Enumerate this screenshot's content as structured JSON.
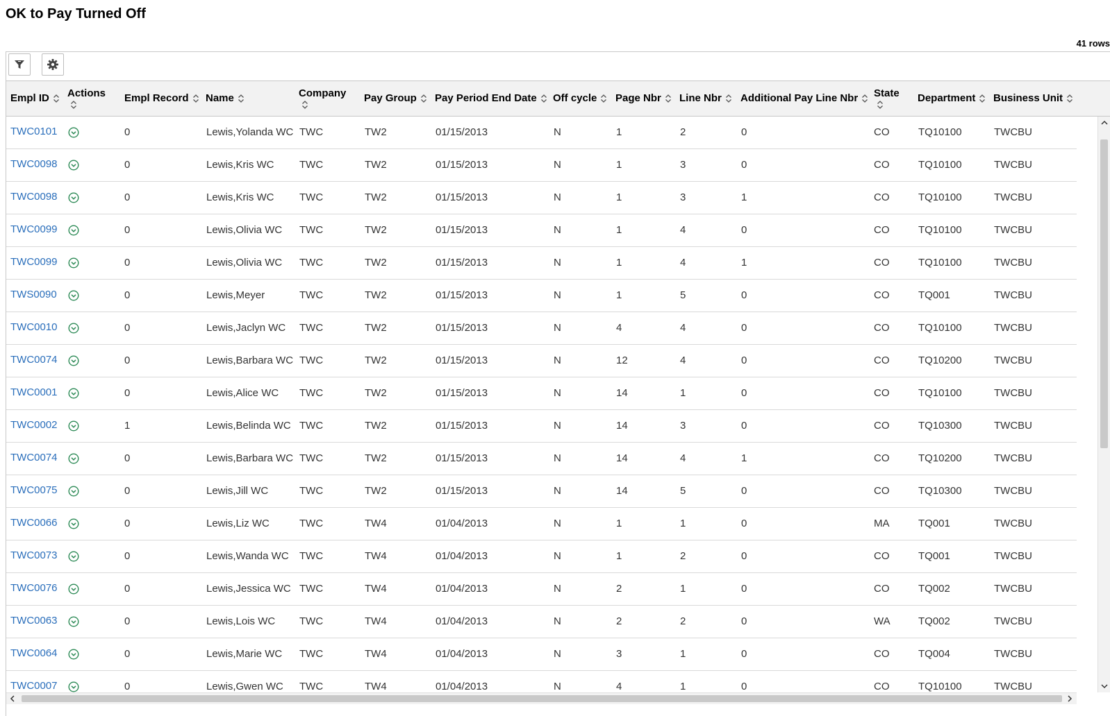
{
  "page": {
    "title": "OK to Pay Turned Off",
    "row_count": "41 rows"
  },
  "toolbar": {
    "filter_icon": "filter-icon",
    "settings_icon": "gear-icon"
  },
  "columns": [
    {
      "key": "empl_id",
      "label": "Empl ID"
    },
    {
      "key": "actions",
      "label": "Actions"
    },
    {
      "key": "empl_record",
      "label": "Empl Record"
    },
    {
      "key": "name",
      "label": "Name"
    },
    {
      "key": "company",
      "label": "Company"
    },
    {
      "key": "pay_group",
      "label": "Pay Group"
    },
    {
      "key": "pay_period_end_date",
      "label": "Pay Period End Date"
    },
    {
      "key": "off_cycle",
      "label": "Off cycle"
    },
    {
      "key": "page_nbr",
      "label": "Page Nbr"
    },
    {
      "key": "line_nbr",
      "label": "Line Nbr"
    },
    {
      "key": "add_pay_line_nbr",
      "label": "Additional Pay Line Nbr"
    },
    {
      "key": "state",
      "label": "State"
    },
    {
      "key": "department",
      "label": "Department"
    },
    {
      "key": "business_unit",
      "label": "Business Unit"
    }
  ],
  "rows": [
    [
      "TWC0101",
      "0",
      "Lewis,Yolanda WC",
      "TWC",
      "TW2",
      "01/15/2013",
      "N",
      "1",
      "2",
      "0",
      "CO",
      "TQ10100",
      "TWCBU"
    ],
    [
      "TWC0098",
      "0",
      "Lewis,Kris WC",
      "TWC",
      "TW2",
      "01/15/2013",
      "N",
      "1",
      "3",
      "0",
      "CO",
      "TQ10100",
      "TWCBU"
    ],
    [
      "TWC0098",
      "0",
      "Lewis,Kris WC",
      "TWC",
      "TW2",
      "01/15/2013",
      "N",
      "1",
      "3",
      "1",
      "CO",
      "TQ10100",
      "TWCBU"
    ],
    [
      "TWC0099",
      "0",
      "Lewis,Olivia WC",
      "TWC",
      "TW2",
      "01/15/2013",
      "N",
      "1",
      "4",
      "0",
      "CO",
      "TQ10100",
      "TWCBU"
    ],
    [
      "TWC0099",
      "0",
      "Lewis,Olivia WC",
      "TWC",
      "TW2",
      "01/15/2013",
      "N",
      "1",
      "4",
      "1",
      "CO",
      "TQ10100",
      "TWCBU"
    ],
    [
      "TWS0090",
      "0",
      "Lewis,Meyer",
      "TWC",
      "TW2",
      "01/15/2013",
      "N",
      "1",
      "5",
      "0",
      "CO",
      "TQ001",
      "TWCBU"
    ],
    [
      "TWC0010",
      "0",
      "Lewis,Jaclyn WC",
      "TWC",
      "TW2",
      "01/15/2013",
      "N",
      "4",
      "4",
      "0",
      "CO",
      "TQ10100",
      "TWCBU"
    ],
    [
      "TWC0074",
      "0",
      "Lewis,Barbara WC",
      "TWC",
      "TW2",
      "01/15/2013",
      "N",
      "12",
      "4",
      "0",
      "CO",
      "TQ10200",
      "TWCBU"
    ],
    [
      "TWC0001",
      "0",
      "Lewis,Alice WC",
      "TWC",
      "TW2",
      "01/15/2013",
      "N",
      "14",
      "1",
      "0",
      "CO",
      "TQ10100",
      "TWCBU"
    ],
    [
      "TWC0002",
      "1",
      "Lewis,Belinda WC",
      "TWC",
      "TW2",
      "01/15/2013",
      "N",
      "14",
      "3",
      "0",
      "CO",
      "TQ10300",
      "TWCBU"
    ],
    [
      "TWC0074",
      "0",
      "Lewis,Barbara WC",
      "TWC",
      "TW2",
      "01/15/2013",
      "N",
      "14",
      "4",
      "1",
      "CO",
      "TQ10200",
      "TWCBU"
    ],
    [
      "TWC0075",
      "0",
      "Lewis,Jill WC",
      "TWC",
      "TW2",
      "01/15/2013",
      "N",
      "14",
      "5",
      "0",
      "CO",
      "TQ10300",
      "TWCBU"
    ],
    [
      "TWC0066",
      "0",
      "Lewis,Liz WC",
      "TWC",
      "TW4",
      "01/04/2013",
      "N",
      "1",
      "1",
      "0",
      "MA",
      "TQ001",
      "TWCBU"
    ],
    [
      "TWC0073",
      "0",
      "Lewis,Wanda WC",
      "TWC",
      "TW4",
      "01/04/2013",
      "N",
      "1",
      "2",
      "0",
      "CO",
      "TQ001",
      "TWCBU"
    ],
    [
      "TWC0076",
      "0",
      "Lewis,Jessica WC",
      "TWC",
      "TW4",
      "01/04/2013",
      "N",
      "2",
      "1",
      "0",
      "CO",
      "TQ002",
      "TWCBU"
    ],
    [
      "TWC0063",
      "0",
      "Lewis,Lois WC",
      "TWC",
      "TW4",
      "01/04/2013",
      "N",
      "2",
      "2",
      "0",
      "WA",
      "TQ002",
      "TWCBU"
    ],
    [
      "TWC0064",
      "0",
      "Lewis,Marie WC",
      "TWC",
      "TW4",
      "01/04/2013",
      "N",
      "3",
      "1",
      "0",
      "CO",
      "TQ004",
      "TWCBU"
    ],
    [
      "TWC0007",
      "0",
      "Lewis,Gwen WC",
      "TWC",
      "TW4",
      "01/04/2013",
      "N",
      "4",
      "1",
      "0",
      "CO",
      "TQ10100",
      "TWCBU"
    ]
  ],
  "colors": {
    "link": "#2a6ebb",
    "action_icon": "#2e8b57",
    "header_bg": "#f2f2f2"
  }
}
